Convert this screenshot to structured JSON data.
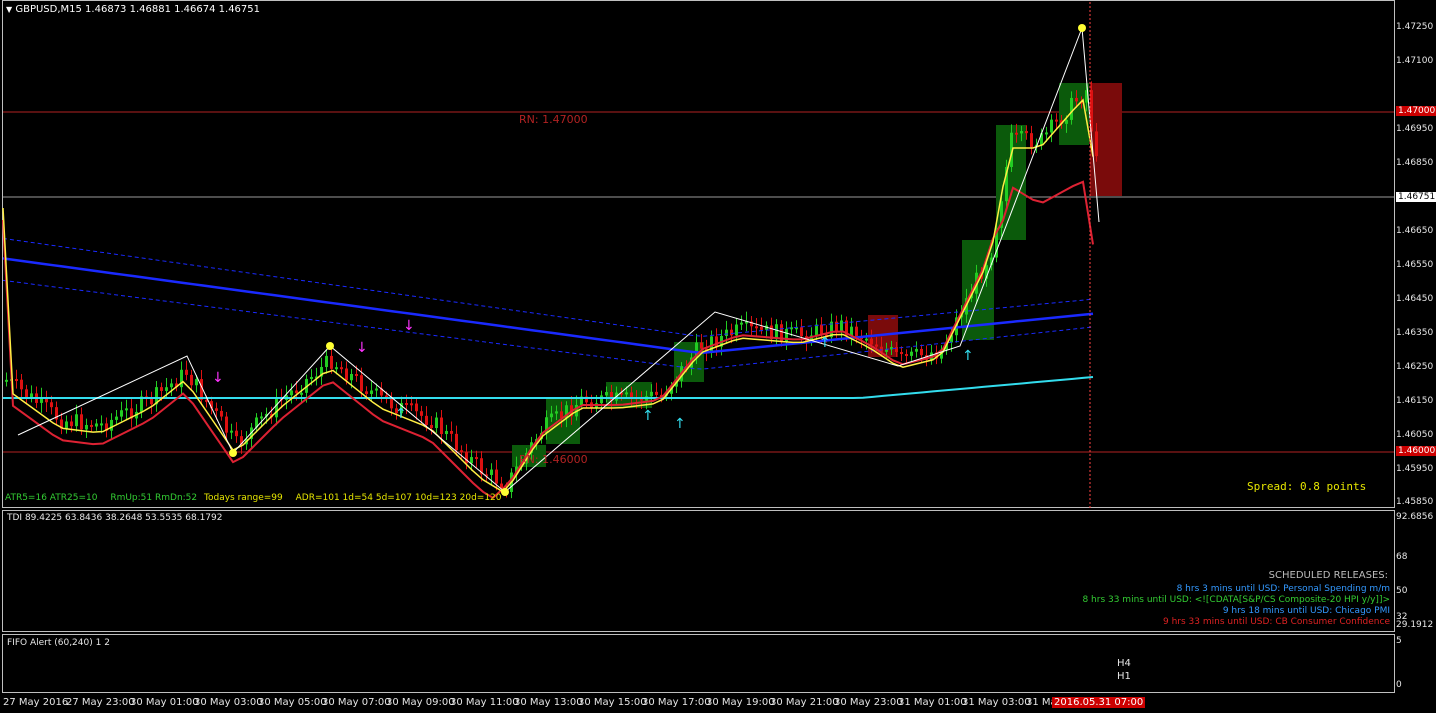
{
  "main": {
    "title": "GBPUSD,M15  1.46873 1.46881 1.46674 1.46751",
    "rn_high": "RN: 1.47000",
    "rn_low": "RN: 1.46000",
    "spread": "Spread: 0.8 points",
    "stats": [
      {
        "text": "ATR5=16  ATR25=10",
        "color": "#33cc33"
      },
      {
        "text": "RmUp:51  RmDn:52",
        "color": "#33cc33"
      },
      {
        "text": "Todays range=99",
        "color": "#e6e600"
      },
      {
        "text": "ADR=101  1d=54  5d=107  10d=123  20d=120",
        "color": "#e6e600"
      }
    ],
    "price_ticks": [
      "1.47250",
      "1.47100",
      "1.46950",
      "1.46850",
      "1.46650",
      "1.46550",
      "1.46450",
      "1.46350",
      "1.46250",
      "1.46150",
      "1.46050",
      "1.45950",
      "1.45850"
    ],
    "price_tags": [
      {
        "text": "1.47000",
        "bg": "#cc0000",
        "fg": "#ffffff"
      },
      {
        "text": "1.46751",
        "bg": "#ffffff",
        "fg": "#000000"
      },
      {
        "text": "1.46000",
        "bg": "#cc0000",
        "fg": "#ffffff"
      }
    ]
  },
  "tdi": {
    "title": "TDI 89.4225 63.8436 38.2648 53.5535 68.1792",
    "ticks": [
      "92.6856",
      "68",
      "50",
      "32",
      "29.1912"
    ],
    "scheduled_title": "SCHEDULED RELEASES:",
    "releases": [
      {
        "text": "8 hrs 3 mins until USD: Personal Spending m/m",
        "color": "#3399ff"
      },
      {
        "text": "8 hrs 33 mins until USD: <![CDATA[S&P/CS Composite-20 HPI y/y]]>",
        "color": "#33cc33"
      },
      {
        "text": "9 hrs 18 mins until USD: Chicago PMI",
        "color": "#3399ff"
      },
      {
        "text": "9 hrs 33 mins until USD: CB Consumer Confidence",
        "color": "#dd2222"
      }
    ]
  },
  "fifo": {
    "title": "FIFO Alert (60,240) 1 2",
    "row_labels": [
      "H4",
      "H1"
    ],
    "ticks": [
      "5",
      "0"
    ]
  },
  "time_axis": {
    "labels": [
      "27 May 2016",
      "27 May 23:00",
      "30 May 01:00",
      "30 May 03:00",
      "30 May 05:00",
      "30 May 07:00",
      "30 May 09:00",
      "30 May 11:00",
      "30 May 13:00",
      "30 May 15:00",
      "30 May 17:00",
      "30 May 19:00",
      "30 May 21:00",
      "30 May 23:00",
      "31 May 01:00",
      "31 May 03:00",
      "31 Ma"
    ],
    "cursor_time": "2016.05.31 07:00"
  },
  "colors": {
    "bull": "#22cc22",
    "bear": "#dd1111",
    "ma_blue": "#1a2aff",
    "ma_cyan": "#33ddee",
    "ma_yellow": "#ffee44",
    "ma_red": "#dd2233"
  }
}
